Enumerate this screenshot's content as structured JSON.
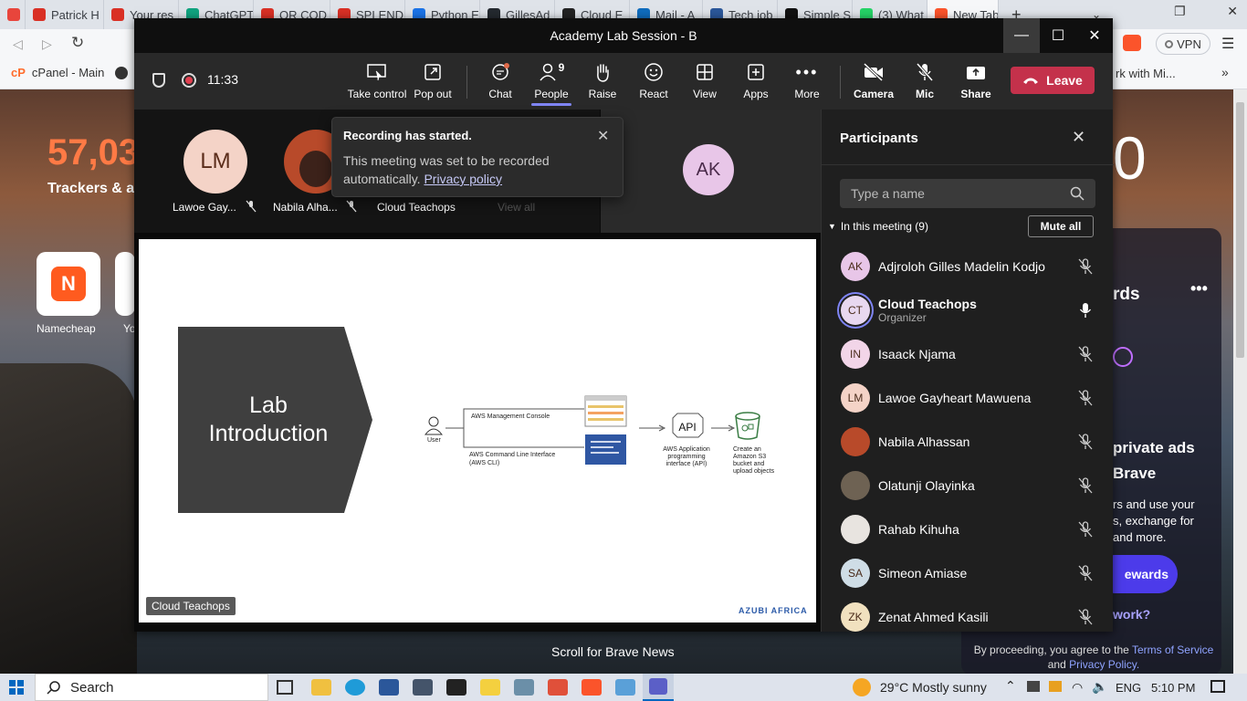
{
  "browser": {
    "tabs": [
      {
        "label": "",
        "color": "#e8453c"
      },
      {
        "label": "Patrick H",
        "color": "#d93025"
      },
      {
        "label": "Your res",
        "color": "#d93025"
      },
      {
        "label": "ChatGPT",
        "color": "#10a37f"
      },
      {
        "label": "QR COD",
        "color": "#d93025"
      },
      {
        "label": "SPLEND",
        "color": "#d93025"
      },
      {
        "label": "Python E",
        "color": "#1a73e8"
      },
      {
        "label": "GillesAd",
        "color": "#24292f"
      },
      {
        "label": "Cloud E",
        "color": "#222222"
      },
      {
        "label": "Mail - A",
        "color": "#0f6cbd"
      },
      {
        "label": "Tech job",
        "color": "#2b579a"
      },
      {
        "label": "Simple S",
        "color": "#111111"
      },
      {
        "label": "(3) What",
        "color": "#25d366"
      },
      {
        "label": "New Tab",
        "color": "#fb542b"
      }
    ],
    "new_tab_symbol": "+",
    "bookmarks": [
      {
        "label": "cPanel - Main"
      }
    ],
    "vpn_label": "VPN",
    "right_bookmark_text": "rk with Mi..."
  },
  "newtab": {
    "trackers_count": "57,03",
    "trackers_label": "Trackers & a",
    "tiles": [
      {
        "label": "Namecheap"
      },
      {
        "label": "Yo"
      }
    ],
    "right_card": {
      "title": "rds",
      "headline1": "private ads",
      "headline2": "Brave",
      "body1": "rs and use your",
      "body2": "s, exchange for",
      "body3": "and more.",
      "button": "ewards",
      "link": "work?",
      "terms_prefix": "By proceeding, you agree to the",
      "terms_link": "Terms of Service",
      "terms_and": "and",
      "privacy_link": "Privacy Policy."
    },
    "scroll_hint": "Scroll for Brave News",
    "big_digit": "0"
  },
  "teams": {
    "window_title": "Academy Lab Session - B",
    "timer": "11:33",
    "toolbar": {
      "take_control": "Take control",
      "pop_out": "Pop out",
      "chat": "Chat",
      "people": "People",
      "people_count": "9",
      "raise": "Raise",
      "react": "React",
      "view": "View",
      "apps": "Apps",
      "more": "More",
      "camera": "Camera",
      "mic": "Mic",
      "share": "Share",
      "leave": "Leave"
    },
    "gallery": [
      {
        "initials": "LM",
        "name": "Lawoe Gay...",
        "color": "#f4d3c7"
      },
      {
        "initials": "",
        "name": "Nabila Alha...",
        "color": "#b84a2a"
      },
      {
        "initials": "",
        "name": "Cloud Teachops",
        "color": "#141414"
      }
    ],
    "view_all": "View all",
    "ak_tile": {
      "initials": "AK",
      "color": "#e8c6e8"
    },
    "toast": {
      "title": "Recording has started.",
      "body": "This meeting was set to be recorded automatically.",
      "link": "Privacy policy"
    },
    "slide": {
      "title1": "Lab",
      "title2": "Introduction",
      "user_label": "User",
      "console_label": "AWS Management Console",
      "cli_label1": "AWS Command Line Interface",
      "cli_label2": "(AWS CLI)",
      "api_box": "API",
      "api_label1": "AWS Application",
      "api_label2": "programming",
      "api_label3": "interface (API)",
      "s3_label1": "Create an",
      "s3_label2": "Amazon S3",
      "s3_label3": "bucket and",
      "s3_label4": "upload objects",
      "brand": "AZUBI AFRICA",
      "presenter_tag": "Cloud Teachops"
    },
    "participants": {
      "title": "Participants",
      "search_placeholder": "Type a name",
      "section_label": "In this meeting (9)",
      "mute_all": "Mute all",
      "list": [
        {
          "initials": "AK",
          "name": "Adjroloh Gilles Madelin Kodjo",
          "role": "",
          "color": "#e8c6e8",
          "muted": true
        },
        {
          "initials": "CT",
          "name": "Cloud Teachops",
          "role": "Organizer",
          "color": "#e8d8f0",
          "muted": false
        },
        {
          "initials": "IN",
          "name": "Isaack Njama",
          "role": "",
          "color": "#f2d5e8",
          "muted": true
        },
        {
          "initials": "LM",
          "name": "Lawoe Gayheart Mawuena",
          "role": "",
          "color": "#f4d3c7",
          "muted": true
        },
        {
          "initials": "",
          "name": "Nabila Alhassan",
          "role": "",
          "color": "#b84a2a",
          "muted": true
        },
        {
          "initials": "",
          "name": "Olatunji Olayinka",
          "role": "",
          "color": "#6e6253",
          "muted": true
        },
        {
          "initials": "",
          "name": "Rahab Kihuha",
          "role": "",
          "color": "#e8e4e0",
          "muted": true
        },
        {
          "initials": "SA",
          "name": "Simeon Amiase",
          "role": "",
          "color": "#cfdde6",
          "muted": true
        },
        {
          "initials": "ZK",
          "name": "Zenat Ahmed Kasili",
          "role": "",
          "color": "#f1e1bf",
          "muted": true
        }
      ]
    }
  },
  "taskbar": {
    "search": "Search",
    "weather": "29°C  Mostly sunny",
    "language": "ENG",
    "time": "5:10 PM"
  }
}
